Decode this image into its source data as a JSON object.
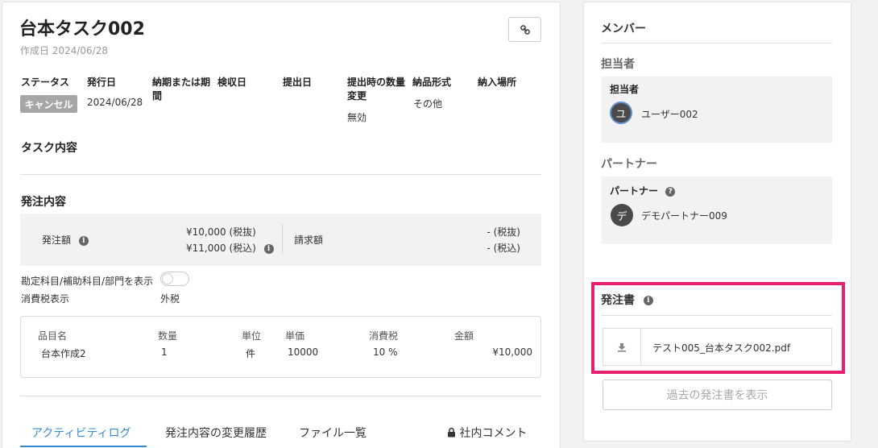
{
  "task": {
    "title": "台本タスク002",
    "created": "作成日 2024/06/28"
  },
  "fields": {
    "status_label": "ステータス",
    "status_value": "キャンセル",
    "issue_date_label": "発行日",
    "issue_date_value": "2024/06/28",
    "due_label": "納期または期間",
    "inspection_label": "検収日",
    "submission_label": "提出日",
    "qty_change_label": "提出時の数量変更",
    "qty_change_value": "無効",
    "delivery_format_label": "納品形式",
    "delivery_format_value": "その他",
    "delivery_place_label": "納入場所"
  },
  "sections": {
    "task_content": "タスク内容",
    "order_content": "発注内容"
  },
  "order": {
    "amount_label": "発注額",
    "amount_excl": "¥10,000 (税抜)",
    "amount_incl": "¥11,000 (税込)",
    "invoice_label": "請求額",
    "invoice_excl": "- (税抜)",
    "invoice_incl": "- (税込)",
    "account_toggle_label": "勘定科目/補助科目/部門を表示",
    "tax_display_label": "消費税表示",
    "tax_display_value": "外税"
  },
  "items_table": {
    "headers": [
      "品目名",
      "数量",
      "単位",
      "単価",
      "消費税",
      "金額"
    ],
    "rows": [
      [
        "台本作成2",
        "1",
        "件",
        "10000",
        "10 %",
        "¥10,000"
      ]
    ]
  },
  "tabs": [
    {
      "label": "アクティビティログ",
      "active": true
    },
    {
      "label": "発注内容の変更履歴",
      "active": false
    },
    {
      "label": "ファイル一覧",
      "active": false
    },
    {
      "label": "社内コメント",
      "active": false
    }
  ],
  "members": {
    "title": "メンバー",
    "assignee_section": "担当者",
    "assignee_box_label": "担当者",
    "assignee_avatar": "ユ",
    "assignee_name": "ユーザー002",
    "partner_section": "パートナー",
    "partner_box_label": "パートナー",
    "partner_avatar": "デ",
    "partner_name": "デモパートナー009"
  },
  "purchase_order": {
    "title": "発注書",
    "file_name": "テスト005_台本タスク002.pdf",
    "past_button": "過去の発注書を表示"
  },
  "colors": {
    "accent": "#3a8bd4",
    "highlight": "#e8206f",
    "status_badge": "#a6a6a6"
  },
  "icons": {
    "link": "link-icon",
    "info": "info-icon",
    "question": "question-icon",
    "download": "download-icon",
    "lock": "lock-icon"
  }
}
